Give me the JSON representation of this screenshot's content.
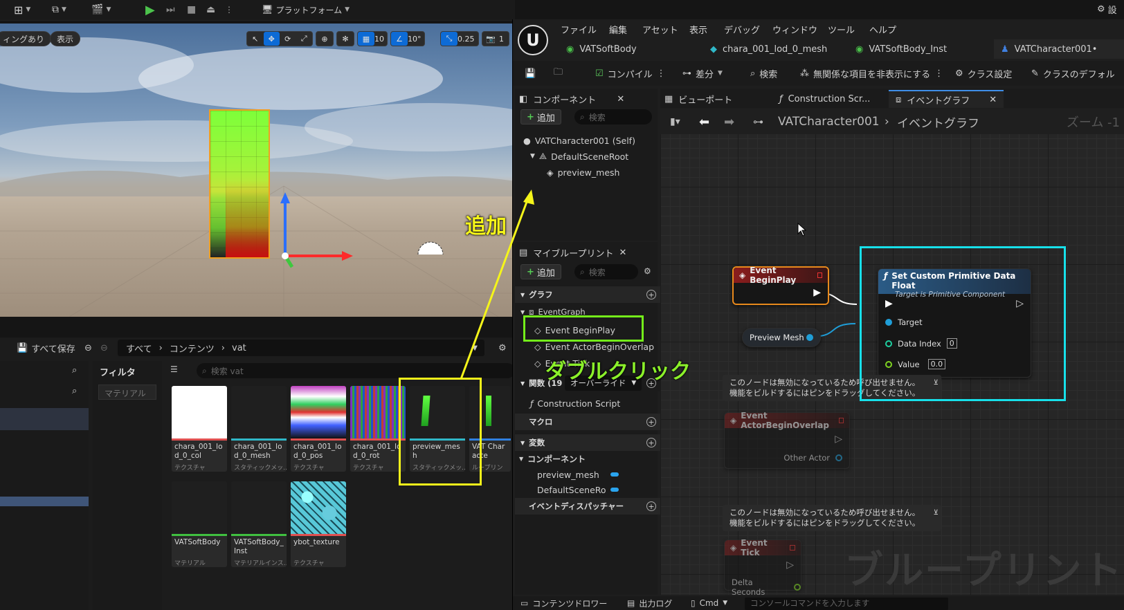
{
  "top_toolbar": {
    "platform_label": "プラットフォーム",
    "settings_label": "設"
  },
  "viewport": {
    "chip_left": "ィングあり",
    "chip_view": "表示",
    "grid_snap": "10",
    "angle_snap": "10°",
    "scale_snap": "0.25",
    "camera_speed": "1"
  },
  "content_browser": {
    "save_all": "すべて保存",
    "breadcrumb": [
      "すべて",
      "コンテンツ",
      "vat"
    ],
    "filter_label": "フィルタ",
    "filter_material": "マテリアル",
    "search_placeholder": "検索 vat",
    "assets": [
      {
        "name": "chara_001_lod_0_col",
        "type": "テクスチャ",
        "color": "#e05050"
      },
      {
        "name": "chara_001_lod_0_mesh",
        "type": "スタティックメッ...",
        "color": "#30b8c8"
      },
      {
        "name": "chara_001_lod_0_pos",
        "type": "テクスチャ",
        "color": "#e05050"
      },
      {
        "name": "chara_001_lod_0_rot",
        "type": "テクスチャ",
        "color": "#e05050"
      },
      {
        "name": "preview_mesh",
        "type": "スタティックメッ...",
        "color": "#30b8c8"
      },
      {
        "name": "VAT Characte",
        "type": "ループリン",
        "color": "#3080e0"
      },
      {
        "name": "VATSoftBody",
        "type": "マテリアル",
        "color": "#40c040"
      },
      {
        "name": "VATSoftBody_Inst",
        "type": "マテリアルインス...",
        "color": "#40c040"
      },
      {
        "name": "ybot_texture",
        "type": "テクスチャ",
        "color": "#e05050"
      }
    ]
  },
  "annotations": {
    "add": "追加",
    "double_click": "ダブルクリック"
  },
  "blueprint": {
    "menu": [
      "ファイル",
      "編集",
      "アセット",
      "表示",
      "デバッグ",
      "ウィンドウ",
      "ツール",
      "ヘルプ"
    ],
    "doc_tabs": [
      "VATSoftBody",
      "chara_001_lod_0_mesh",
      "VATSoftBody_Inst",
      "VATCharacter001•"
    ],
    "toolbar": {
      "compile": "コンパイル",
      "diff": "差分",
      "find": "検索",
      "hide_unrelated": "無関係な項目を非表示にする",
      "class_settings": "クラス設定",
      "class_defaults": "クラスのデフォル"
    },
    "components": {
      "title": "コンポーネント",
      "add": "追加",
      "search_placeholder": "検索",
      "tree": [
        "VATCharacter001 (Self)",
        "DefaultSceneRoot",
        "preview_mesh"
      ]
    },
    "my_blueprint": {
      "title": "マイブループリント",
      "add": "追加",
      "search_placeholder": "検索",
      "graphs_label": "グラフ",
      "event_graph": "EventGraph",
      "events": [
        "Event BeginPlay",
        "Event ActorBeginOverlap",
        "Event Tick"
      ],
      "functions_label": "関数 (19 オ",
      "override_label": "オーバーライド",
      "construction_script": "Construction Script",
      "macros_label": "マクロ",
      "variables_label": "変数",
      "components_label": "コンポーネント",
      "component_vars": [
        "preview_mesh",
        "DefaultSceneRoo"
      ],
      "dispatchers_label": "イベントディスパッチャー"
    },
    "graph_tabs": [
      "ビューポート",
      "Construction Scr...",
      "イベントグラフ"
    ],
    "graph": {
      "breadcrumb_class": "VATCharacter001",
      "breadcrumb_graph": "イベントグラフ",
      "zoom": "ズーム -1",
      "watermark": "ブループリント",
      "node_begin_play": "Event BeginPlay",
      "node_set_title": "Set Custom Primitive Data Float",
      "node_set_subtitle": "Target is Primitive Component",
      "pin_target": "Target",
      "pin_data_index": "Data Index",
      "pin_data_index_value": "0",
      "pin_value": "Value",
      "pin_value_value": "0.0",
      "node_preview_mesh": "Preview Mesh",
      "disabled_comment_line1": "このノードは無効になっているため呼び出せません。",
      "disabled_comment_line2a": "機能をビルドするにはピンをドラッグしてください。",
      "node_overlap": "Event ActorBeginOverlap",
      "pin_other_actor": "Other Actor",
      "node_tick": "Event Tick",
      "pin_delta_seconds": "Delta Seconds"
    },
    "bottom": {
      "content_drawer": "コンテンツドロワー",
      "output_log": "出力ログ",
      "cmd": "Cmd",
      "console_placeholder": "コンソールコマンドを入力します"
    }
  }
}
